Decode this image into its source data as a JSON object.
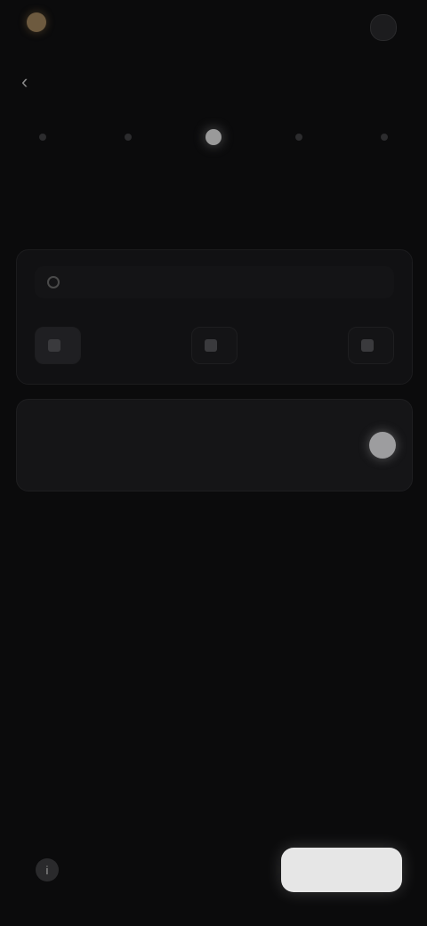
{
  "app": {
    "brand_name": "",
    "top_action": ""
  },
  "nav": {
    "back_icon": "back-arrow-icon"
  },
  "steps": [
    {
      "label": "",
      "active": false
    },
    {
      "label": "",
      "active": false
    },
    {
      "label": "",
      "active": true
    },
    {
      "label": "",
      "active": false
    },
    {
      "label": "",
      "active": false
    }
  ],
  "section": {
    "title": "",
    "link": ""
  },
  "search": {
    "placeholder": "",
    "value": ""
  },
  "chips": [
    {
      "label": "",
      "selected": true
    },
    {
      "label": "",
      "selected": false
    },
    {
      "label": "",
      "selected": false
    }
  ],
  "card": {
    "title": "",
    "subtitle": "",
    "toggle_on": true
  },
  "footer": {
    "info_text": "",
    "primary_label": ""
  },
  "colors": {
    "background": "#0b0b0c",
    "accent": "#e6e6e6",
    "brand_dot": "#6d5a3f"
  }
}
